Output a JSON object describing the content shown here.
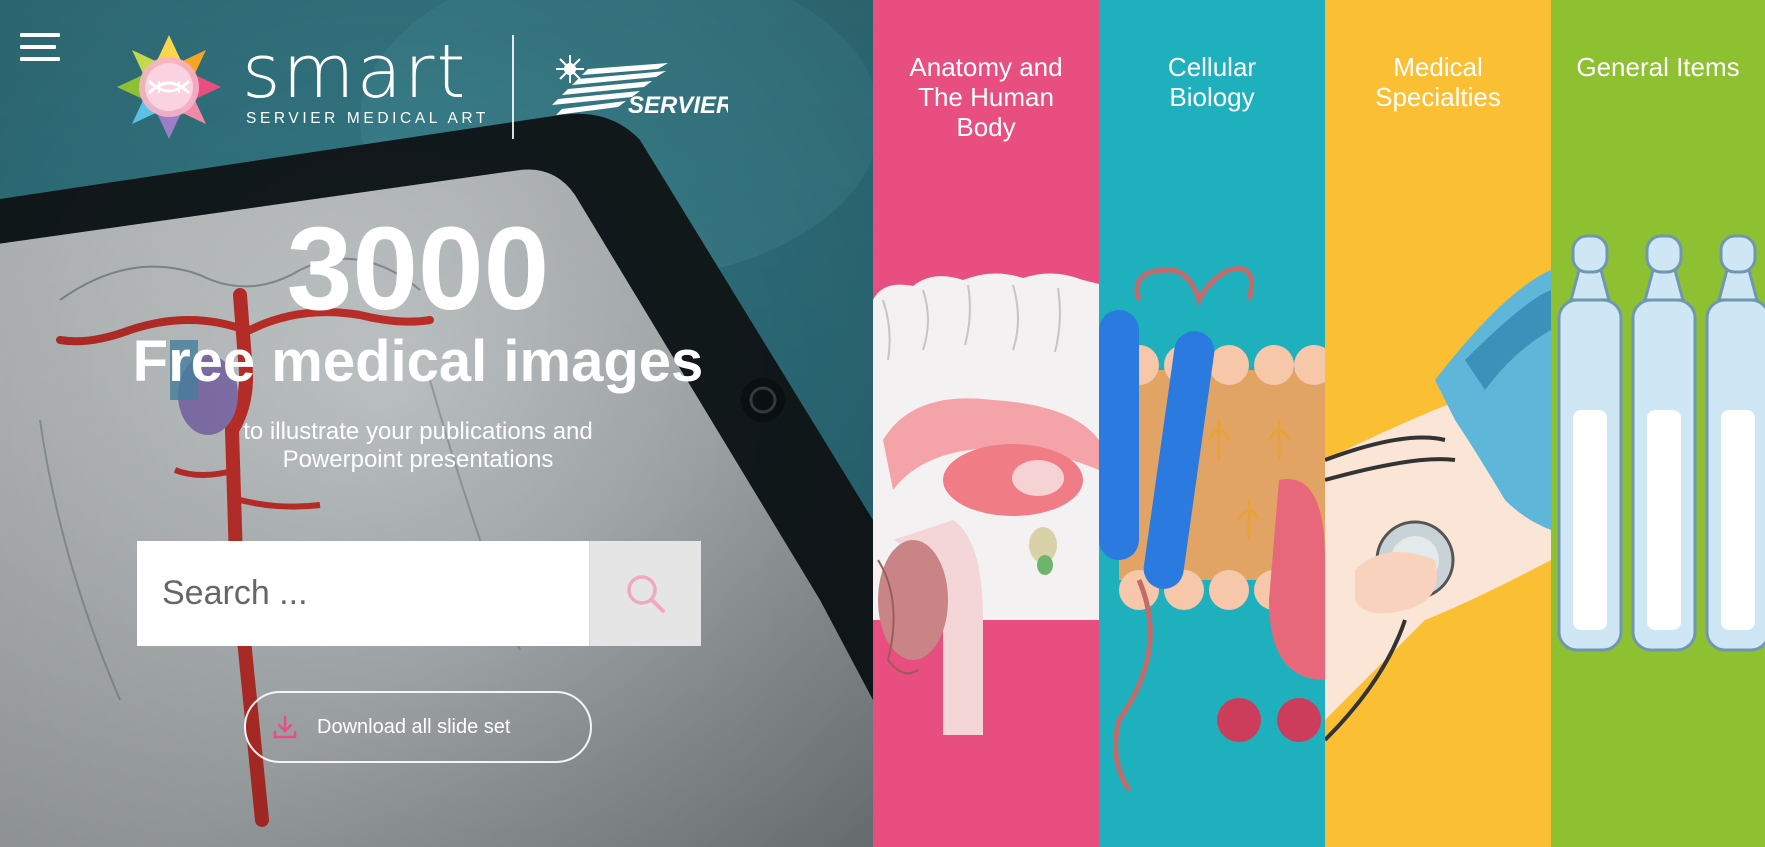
{
  "header": {
    "brand_name": "smart",
    "brand_subtitle": "SERVIER MEDICAL ART",
    "partner_logo_text": "SERVIER",
    "menu_icon": "hamburger-menu-icon"
  },
  "hero": {
    "count": "3000",
    "headline": "Free medical images",
    "sub_line1": "to illustrate your publications and",
    "sub_line2": "Powerpoint presentations"
  },
  "search": {
    "placeholder": "Search ...",
    "value": "",
    "icon": "search-icon"
  },
  "download": {
    "label": "Download all slide set",
    "icon": "download-icon"
  },
  "categories": [
    {
      "line1": "Anatomy and",
      "line2": "The Human",
      "line3": "Body",
      "color": "#e84e7f",
      "illustration": "brain-section"
    },
    {
      "line1": "Cellular",
      "line2": "Biology",
      "line3": "",
      "color": "#1fb0bd",
      "illustration": "cell-membrane-protein"
    },
    {
      "line1": "Medical",
      "line2": "Specialties",
      "line3": "",
      "color": "#fbbf33",
      "illustration": "stethoscope-blood-pressure"
    },
    {
      "line1": "General Items",
      "line2": "",
      "line3": "",
      "color": "#8ec132",
      "illustration": "ampoules"
    }
  ],
  "colors": {
    "accent_pink": "#e84e7f",
    "teal": "#1fb0bd",
    "yellow": "#fbbf33",
    "green": "#8ec132"
  }
}
